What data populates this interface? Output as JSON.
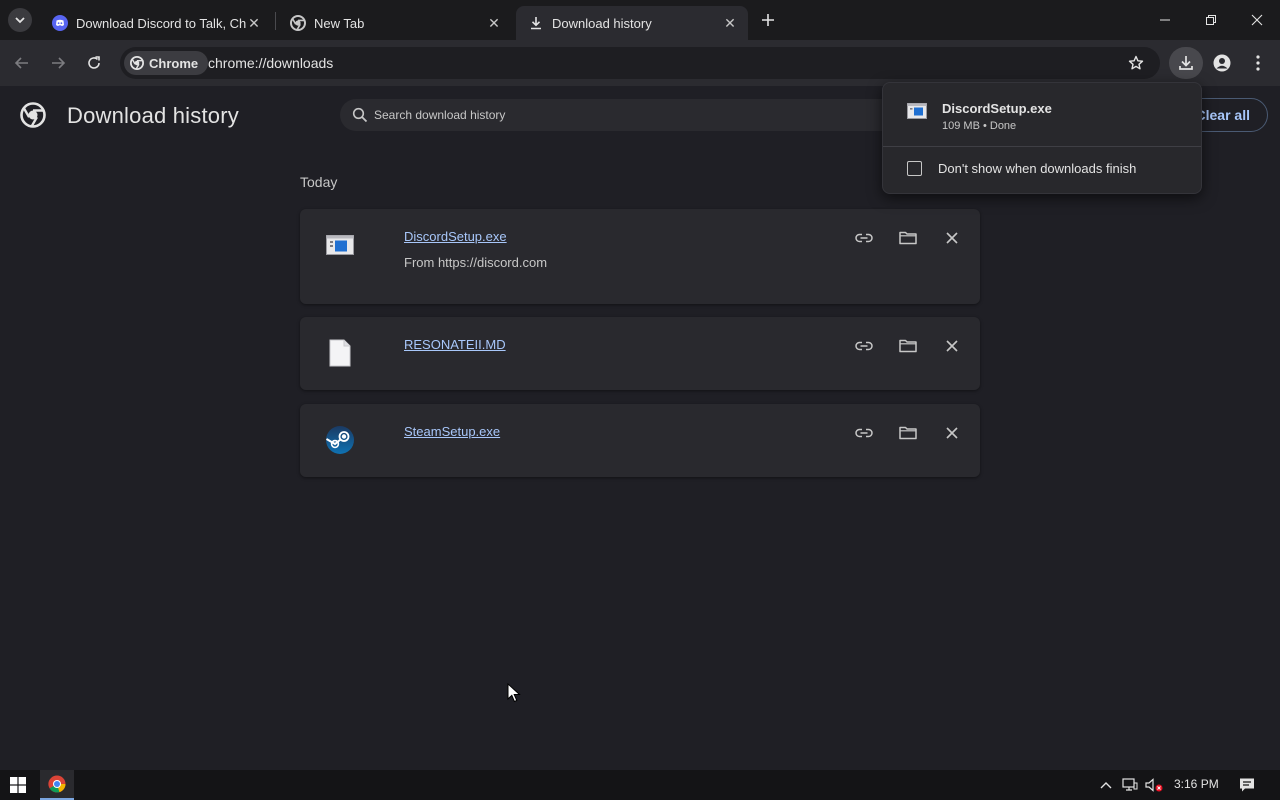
{
  "browser": {
    "tabs": [
      {
        "title": "Download Discord to Talk, Chat",
        "favicon": "discord-icon"
      },
      {
        "title": "New Tab",
        "favicon": "chrome-icon"
      },
      {
        "title": "Download history",
        "favicon": "download-icon",
        "active": true
      }
    ],
    "chip_label": "Chrome",
    "url": "chrome://downloads"
  },
  "page": {
    "title": "Download history",
    "search_placeholder": "Search download history",
    "clear_all_label": "Clear all",
    "section_label": "Today"
  },
  "downloads": [
    {
      "file_name": "DiscordSetup.exe",
      "source": "From https://discord.com",
      "icon": "exe-window-icon"
    },
    {
      "file_name": "RESONATEII.MD",
      "source": "",
      "icon": "document-icon"
    },
    {
      "file_name": "SteamSetup.exe",
      "source": "",
      "icon": "steam-icon"
    }
  ],
  "bubble": {
    "file_name": "DiscordSetup.exe",
    "status": "109 MB • Done",
    "checkbox_label": "Don't show when downloads finish",
    "checkbox_checked": false
  },
  "taskbar": {
    "time": "3:16 PM"
  },
  "colors": {
    "background": "#1f1f25",
    "card": "#29292e",
    "link": "#a8c7fa",
    "toolbar": "#2b2b30"
  }
}
